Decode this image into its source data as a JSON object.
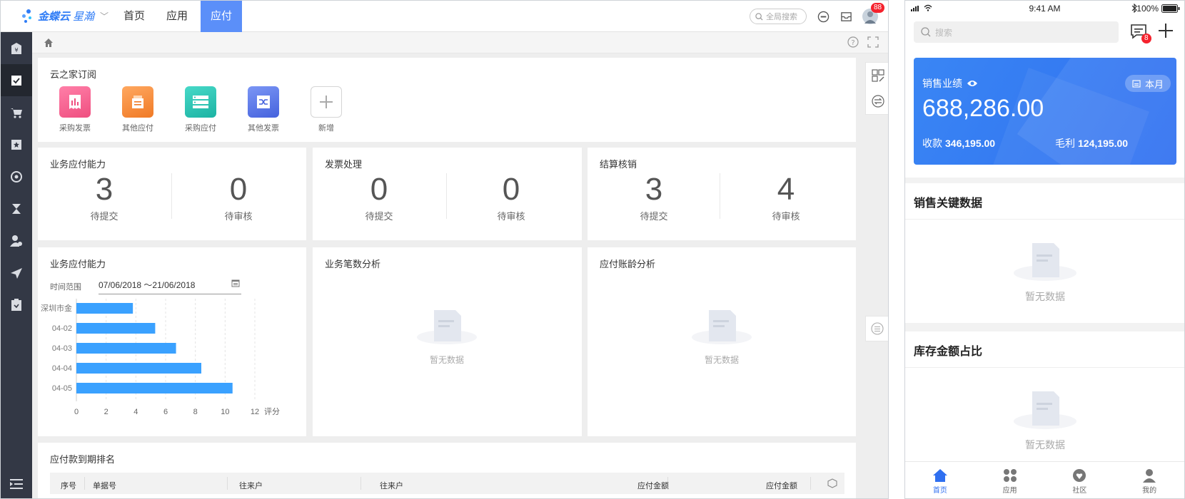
{
  "app": {
    "brand": "金蝶云",
    "brand_sub": "星瀚",
    "nav": [
      "首页",
      "应用",
      "应付"
    ],
    "search_placeholder": "全局搜索",
    "notify_count": "88"
  },
  "subscriptions": {
    "title": "云之家订阅",
    "items": [
      {
        "label": "采购发票",
        "color": "#f25e8e",
        "icon": "invoice-chart-icon"
      },
      {
        "label": "其他应付",
        "color": "#f5913b",
        "icon": "document-stack-icon"
      },
      {
        "label": "采购应付",
        "color": "#2cc3b4",
        "icon": "list-icon"
      },
      {
        "label": "其他发票",
        "color": "#5577e6",
        "icon": "shuffle-icon"
      }
    ],
    "add_label": "新增"
  },
  "stats": [
    {
      "title": "业务应付能力",
      "a_value": "3",
      "a_label": "待提交",
      "b_value": "0",
      "b_label": "待审核"
    },
    {
      "title": "发票处理",
      "a_value": "0",
      "a_label": "待提交",
      "b_value": "0",
      "b_label": "待审核"
    },
    {
      "title": "结算核销",
      "a_value": "3",
      "a_label": "待提交",
      "b_value": "4",
      "b_label": "待审核"
    }
  ],
  "chart_card": {
    "title": "业务应付能力",
    "range_label": "时间范围",
    "range_value": "07/06/2018 ～21/06/2018"
  },
  "chart_data": {
    "type": "bar",
    "orientation": "horizontal",
    "categories": [
      "深圳市金",
      "04-02",
      "04-03",
      "04-04",
      "04-05"
    ],
    "values": [
      3.8,
      5.3,
      6.7,
      8.4,
      10.5
    ],
    "xticks": [
      "0",
      "2",
      "4",
      "6",
      "8",
      "10",
      "12"
    ],
    "xlabel": "评分",
    "xlim": [
      0,
      12
    ],
    "color": "#3aa1ff",
    "grid": "vertical dashed"
  },
  "analysis_cards": [
    {
      "title": "业务笔数分析",
      "empty": "暂无数据"
    },
    {
      "title": "应付账龄分析",
      "empty": "暂无数据"
    }
  ],
  "ranking": {
    "title": "应付款到期排名",
    "columns": [
      "序号",
      "单据号",
      "往来户",
      "往来户",
      "应付金额",
      "应付金额"
    ]
  },
  "mobile": {
    "time": "9:41 AM",
    "battery": "100%",
    "search_placeholder": "搜索",
    "msg_count": "8",
    "card": {
      "label": "销售业绩",
      "value": "688,286.00",
      "period": "本月",
      "receipt_label": "收款",
      "receipt_value": "346,195.00",
      "gross_label": "毛利",
      "gross_value": "124,195.00"
    },
    "sections": [
      {
        "title": "销售关键数据",
        "empty": "暂无数据"
      },
      {
        "title": "库存金额占比",
        "empty": "暂无数据"
      }
    ],
    "tabs": [
      "首页",
      "应用",
      "社区",
      "我的"
    ]
  }
}
